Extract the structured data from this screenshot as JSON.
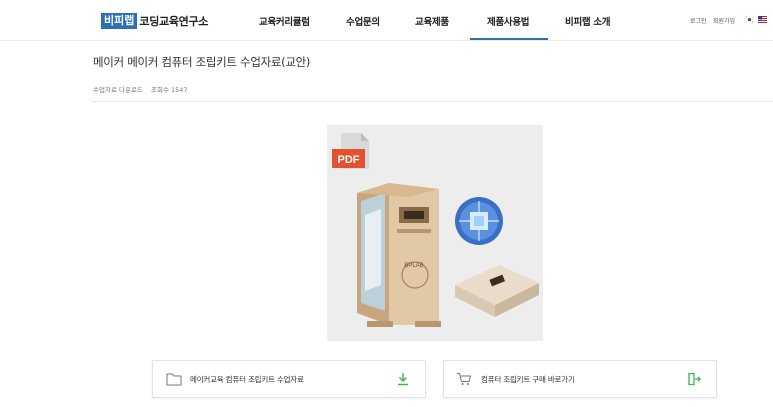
{
  "logo": {
    "badge": "비피랩",
    "text": "코딩교육연구소"
  },
  "nav": {
    "items": [
      {
        "label": "교육커리큘럼"
      },
      {
        "label": "수업문의"
      },
      {
        "label": "교육제품"
      },
      {
        "label": "제품사용법"
      },
      {
        "label": "비피랩 소개"
      }
    ],
    "active_index": 3
  },
  "util": {
    "login": "로그인",
    "signup": "회원가입"
  },
  "colors": {
    "accent": "#2b6fb6",
    "download_green": "#3cb44b",
    "pdf_red": "#e2522f"
  },
  "post": {
    "title": "메이커  메이커 컴퓨터 조립키트 수업자료(교안)",
    "category": "수업자료 다운로드",
    "views": "조회수 1547"
  },
  "product_image": {
    "pdf_label": "PDF",
    "box_lettering": "BPLAB"
  },
  "cards": [
    {
      "label": "메이커교육 컴퓨터 조립키트 수업자료",
      "icon": "folder-icon",
      "action_icon": "download-icon"
    },
    {
      "label": "컴퓨터 조립키트 구매 바로가기",
      "icon": "cart-icon",
      "action_icon": "exit-icon"
    }
  ]
}
